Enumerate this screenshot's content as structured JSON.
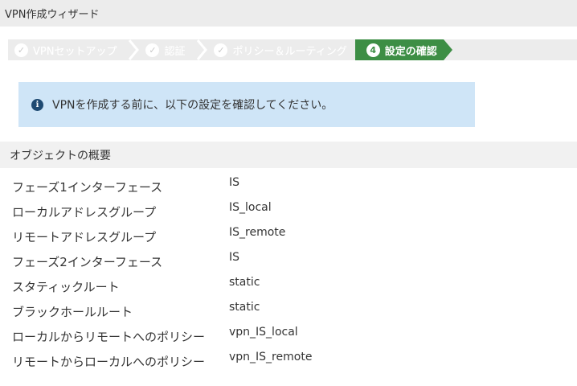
{
  "window": {
    "title": "VPN作成ウィザード"
  },
  "wizard": {
    "steps": [
      {
        "label": "VPNセットアップ",
        "state": "done",
        "icon": "check-icon"
      },
      {
        "label": "認証",
        "state": "done",
        "icon": "check-icon"
      },
      {
        "label": "ポリシー＆ルーティング",
        "state": "done",
        "icon": "check-icon"
      },
      {
        "label": "設定の確認",
        "state": "active",
        "number": "4"
      }
    ],
    "active_color": "#3d8e45"
  },
  "info": {
    "icon": "info-icon",
    "message": "VPNを作成する前に、以下の設定を確認してください。"
  },
  "summary": {
    "header": "オブジェクトの概要",
    "rows": [
      {
        "label": "フェーズ1インターフェース",
        "value": "IS"
      },
      {
        "label": "ローカルアドレスグループ",
        "value": "IS_local"
      },
      {
        "label": "リモートアドレスグループ",
        "value": "IS_remote"
      },
      {
        "label": "フェーズ2インターフェース",
        "value": "IS"
      },
      {
        "label": "スタティックルート",
        "value": "static"
      },
      {
        "label": "ブラックホールルート",
        "value": "static"
      },
      {
        "label": "ローカルからリモートへのポリシー",
        "value": "vpn_IS_local"
      },
      {
        "label": "リモートからローカルへのポリシー",
        "value": "vpn_IS_remote"
      }
    ]
  }
}
